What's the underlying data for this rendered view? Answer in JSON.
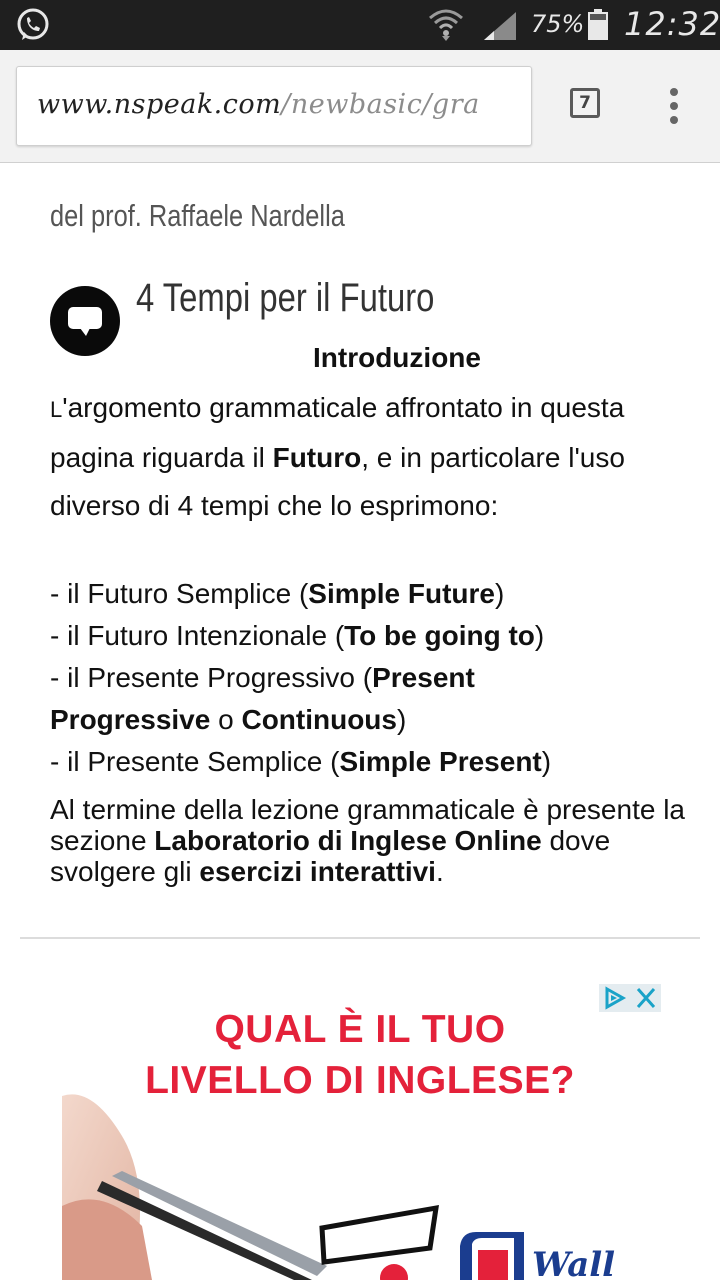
{
  "status_bar": {
    "battery_percent": "75%",
    "time": "12:32"
  },
  "browser": {
    "url_domain": "www.nspeak.com",
    "url_path": "/newbasic/gra",
    "tab_count": "7"
  },
  "article": {
    "byline": "del prof. Raffaele Nardella",
    "title": "4 Tempi per il Futuro",
    "section_heading": "Introduzione",
    "intro": {
      "first_letter": "L",
      "text_1": "'argomento grammaticale affrontato in questa pagina riguarda il ",
      "bold_1": "Futuro",
      "text_2": ", e in particolare l'uso diverso di 4 tempi che lo esprimono:"
    },
    "list": [
      {
        "prefix": "- il Futuro Semplice (",
        "bold": "Simple Future",
        "suffix": ")"
      },
      {
        "prefix": "- il Futuro Intenzionale (",
        "bold": "To be going to",
        "suffix": ")"
      },
      {
        "prefix": "- il Presente Progressivo (",
        "bold": "Present",
        "suffix": ""
      },
      {
        "prefix": "",
        "bold": "Progressive",
        "mid": " o ",
        "bold2": "Continuous",
        "suffix": ")"
      },
      {
        "prefix": "- il Presente Semplice (",
        "bold": "Simple Present",
        "suffix": ")"
      }
    ],
    "closing": {
      "text_1": "Al termine della lezione grammaticale è presente la sezione ",
      "bold_1": "Laboratorio di Inglese Online",
      "text_2": " dove svolgere gli ",
      "bold_2": "esercizi interattivi",
      "text_3": "."
    }
  },
  "ad": {
    "line_1": "QUAL È IL TUO",
    "line_2": "LIVELLO DI INGLESE?",
    "brand_color": "#e4213a"
  },
  "icons": {
    "status_left": "whatsapp-icon",
    "status_right": [
      "wifi-icon",
      "signal-icon",
      "battery-icon"
    ],
    "toolbar": [
      "tabs-icon",
      "overflow-menu-icon"
    ],
    "article": "chat-bubble-icon",
    "ad": [
      "adchoices-icon",
      "ad-close-icon"
    ]
  }
}
